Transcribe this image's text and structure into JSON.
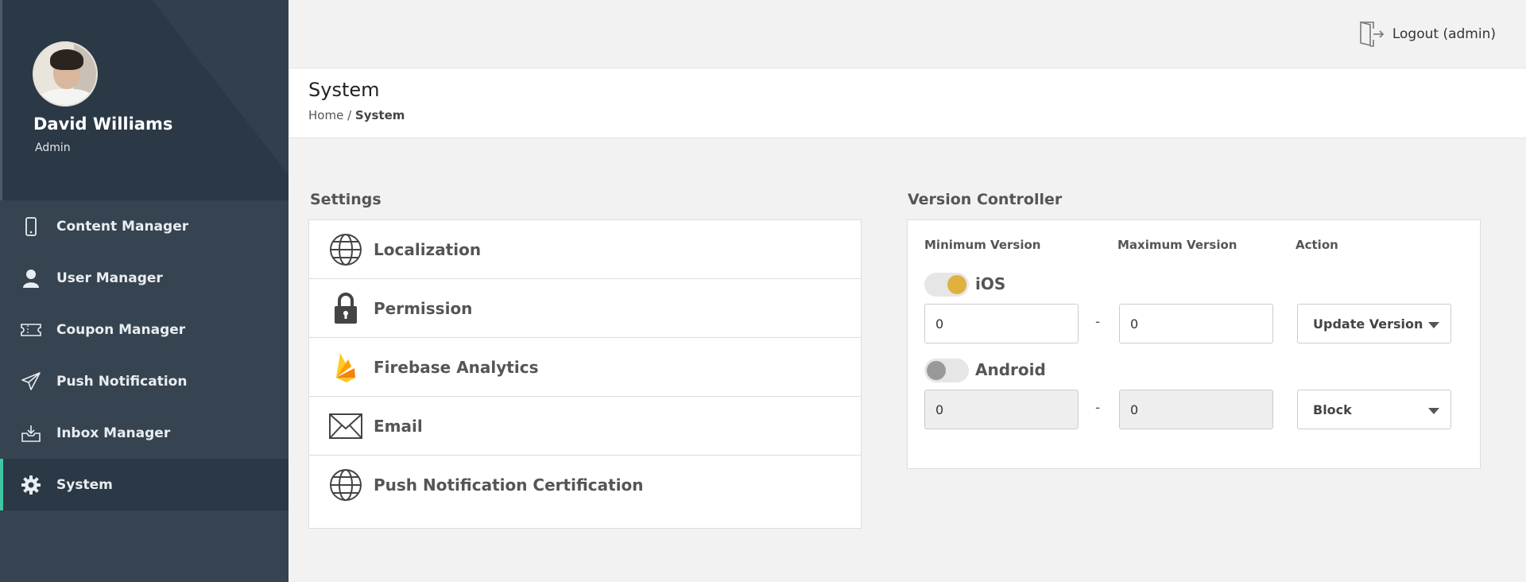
{
  "user": {
    "name": "David Williams",
    "role": "Admin"
  },
  "menu": [
    {
      "label": "Content Manager",
      "icon": "phone-icon"
    },
    {
      "label": "User Manager",
      "icon": "user-icon"
    },
    {
      "label": "Coupon Manager",
      "icon": "ticket-icon"
    },
    {
      "label": "Push Notification",
      "icon": "paper-plane-icon"
    },
    {
      "label": "Inbox Manager",
      "icon": "inbox-icon"
    },
    {
      "label": "System",
      "icon": "gear-icon",
      "active": true
    }
  ],
  "topbar": {
    "logout_label": "Logout (admin)"
  },
  "page": {
    "title": "System",
    "breadcrumb_home": "Home",
    "breadcrumb_sep": " / ",
    "breadcrumb_current": "System"
  },
  "settings": {
    "title": "Settings",
    "items": [
      {
        "label": "Localization",
        "icon": "globe-icon"
      },
      {
        "label": "Permission",
        "icon": "lock-icon"
      },
      {
        "label": "Firebase Analytics",
        "icon": "firebase-icon"
      },
      {
        "label": "Email",
        "icon": "envelope-icon"
      },
      {
        "label": "Push Notification Certification",
        "icon": "globe-icon"
      }
    ]
  },
  "version_controller": {
    "title": "Version Controller",
    "headers": {
      "min": "Minimum Version",
      "max": "Maximum Version",
      "action": "Action"
    },
    "separator": "-",
    "platforms": [
      {
        "name": "iOS",
        "enabled": true,
        "min": "0",
        "max": "0",
        "action": "Update Version"
      },
      {
        "name": "Android",
        "enabled": false,
        "min": "0",
        "max": "0",
        "action": "Block"
      }
    ]
  },
  "colors": {
    "sidebar": "#364350",
    "sidebar_dark": "#2b3846",
    "active_accent": "#3ec7a2",
    "toggle_on": "#e0b13e"
  }
}
